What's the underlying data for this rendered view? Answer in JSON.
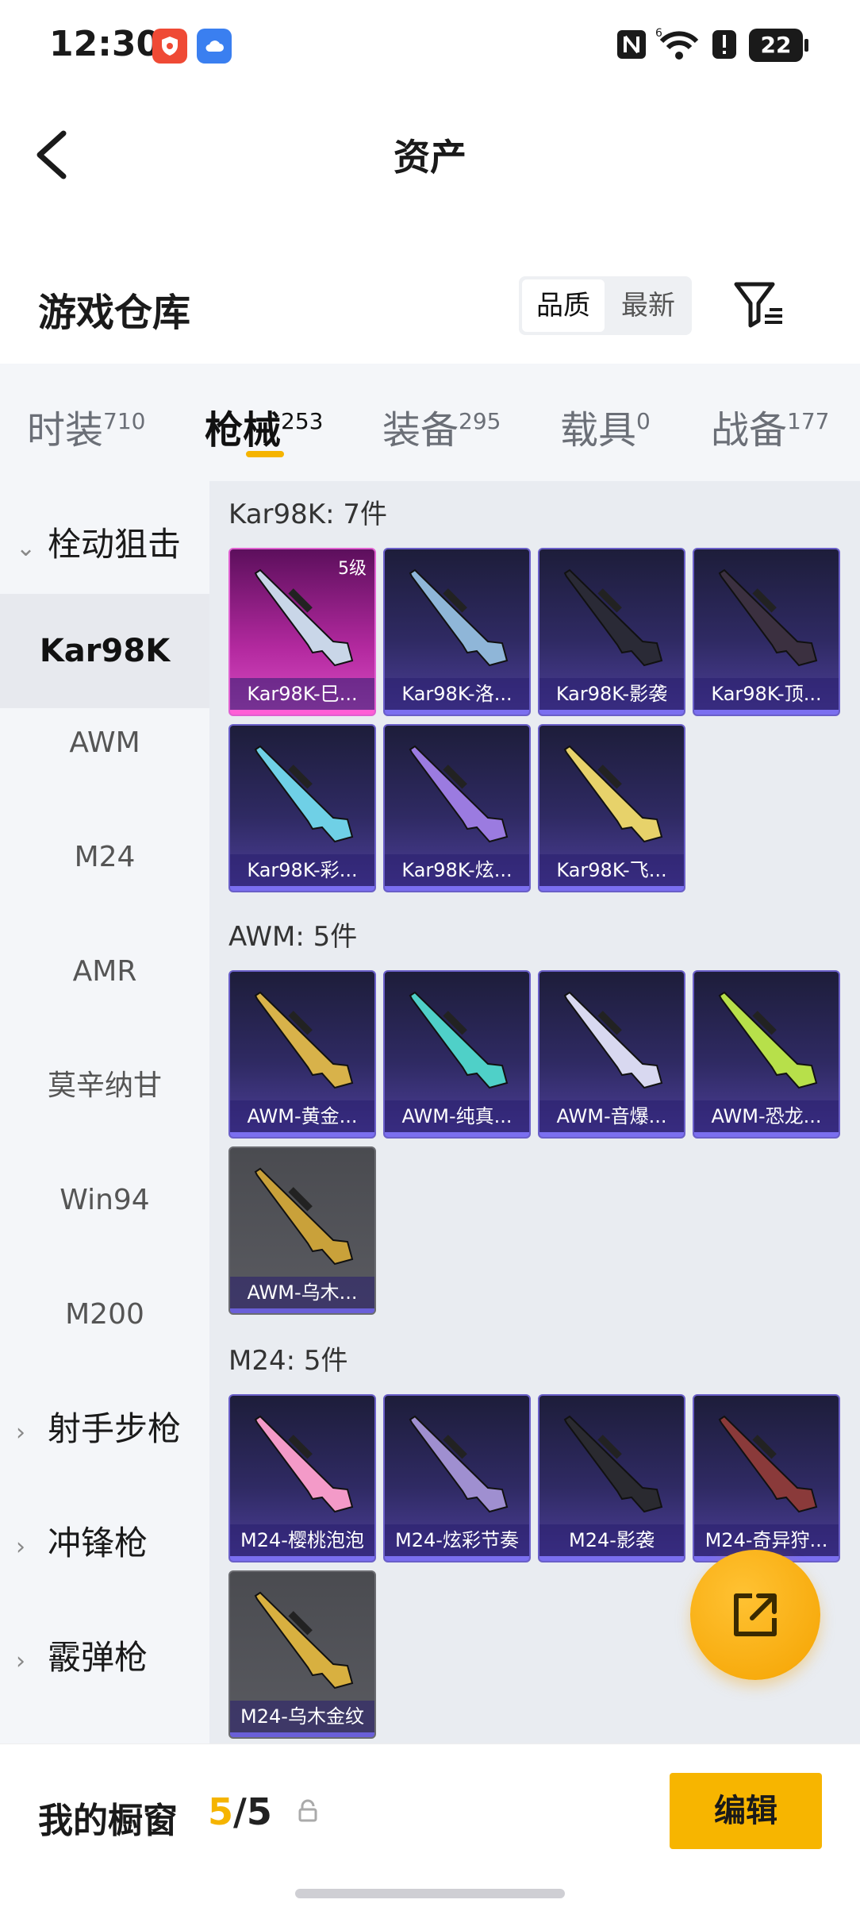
{
  "status_bar": {
    "time": "12:30",
    "battery": "22",
    "icons": [
      "shield-icon",
      "cloud-icon",
      "nfc-icon",
      "wifi-icon",
      "alert-icon",
      "battery-icon"
    ]
  },
  "header": {
    "title": "资产",
    "back_icon": "back-arrow-icon"
  },
  "warehouse": {
    "title": "游戏仓库",
    "sort_options": [
      "品质",
      "最新"
    ],
    "selected_sort": "品质",
    "filter_icon": "filter-icon"
  },
  "tabs": [
    {
      "label": "时装",
      "count": "710"
    },
    {
      "label": "枪械",
      "count": "253",
      "active": true
    },
    {
      "label": "装备",
      "count": "295"
    },
    {
      "label": "载具",
      "count": "0"
    },
    {
      "label": "战备",
      "count": "177"
    }
  ],
  "sidebar": {
    "groups": [
      {
        "label": "栓动狙击",
        "expanded": true
      },
      {
        "label": "射手步枪"
      },
      {
        "label": "冲锋枪"
      },
      {
        "label": "霰弹枪"
      }
    ],
    "items": [
      {
        "label": "Kar98K",
        "selected": true
      },
      {
        "label": "AWM"
      },
      {
        "label": "M24"
      },
      {
        "label": "AMR"
      },
      {
        "label": "莫辛纳甘"
      },
      {
        "label": "Win94"
      },
      {
        "label": "M200"
      }
    ]
  },
  "sections": [
    {
      "title": "Kar98K: 7件",
      "items": [
        {
          "name": "Kar98K-巳...",
          "level": "5级",
          "style": "pink"
        },
        {
          "name": "Kar98K-洛...",
          "style": "purple"
        },
        {
          "name": "Kar98K-影袭",
          "style": "purple"
        },
        {
          "name": "Kar98K-顶...",
          "style": "purple"
        },
        {
          "name": "Kar98K-彩...",
          "style": "purple"
        },
        {
          "name": "Kar98K-炫...",
          "style": "purple"
        },
        {
          "name": "Kar98K-飞...",
          "style": "purple"
        }
      ]
    },
    {
      "title": "AWM: 5件",
      "items": [
        {
          "name": "AWM-黄金...",
          "style": "purple"
        },
        {
          "name": "AWM-纯真...",
          "style": "purple"
        },
        {
          "name": "AWM-音爆...",
          "style": "purple"
        },
        {
          "name": "AWM-恐龙...",
          "style": "purple"
        },
        {
          "name": "AWM-乌木...",
          "style": "gray"
        }
      ]
    },
    {
      "title": "M24: 5件",
      "items": [
        {
          "name": "M24-樱桃泡泡",
          "style": "purple"
        },
        {
          "name": "M24-炫彩节奏",
          "style": "purple"
        },
        {
          "name": "M24-影袭",
          "style": "purple"
        },
        {
          "name": "M24-奇异狩...",
          "style": "purple"
        },
        {
          "name": "M24-乌木金纹",
          "style": "gray"
        }
      ]
    }
  ],
  "fab": {
    "icon": "share-icon"
  },
  "bottom_bar": {
    "label": "我的橱窗",
    "used": "5",
    "separator": "/",
    "total": "5",
    "lock_icon": "lock-icon",
    "edit_label": "编辑"
  },
  "colors": {
    "accent": "#f5b400",
    "card_purple": "#4d3f9a",
    "card_pink": "#d84dc4",
    "card_gray": "#5a5b61"
  }
}
